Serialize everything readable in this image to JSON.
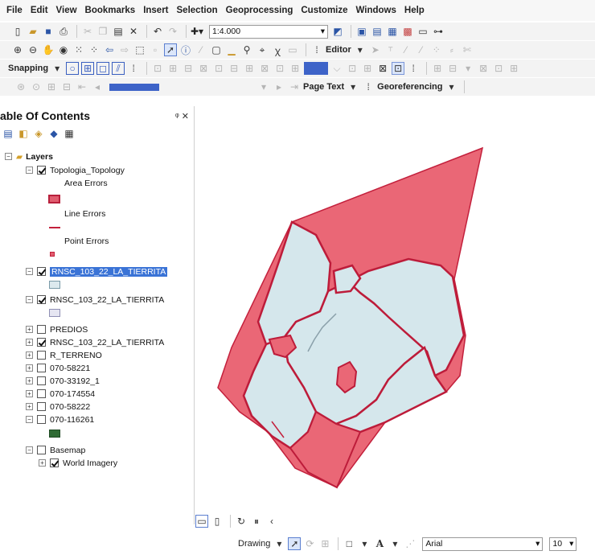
{
  "menu": [
    "File",
    "Edit",
    "View",
    "Bookmarks",
    "Insert",
    "Selection",
    "Geoprocessing",
    "Customize",
    "Windows",
    "Help"
  ],
  "toolbar": {
    "scale": "1:4.000",
    "editor_label": "Editor",
    "snapping_label": "Snapping",
    "page_text_label": "Page Text",
    "georeferencing_label": "Georeferencing"
  },
  "toc": {
    "title": "able Of Contents",
    "pin": "ᵠ ✕",
    "layers_root": "Layers",
    "topology": "Topologia_Topology",
    "area_errors": "Area Errors",
    "line_errors": "Line Errors",
    "point_errors": "Point Errors",
    "layer1": "RNSC_103_22_LA_TIERRITA",
    "layer2": "RNSC_103_22_LA_TIERRITA",
    "predios": "PREDIOS",
    "layer3": "RNSC_103_22_LA_TIERRITA",
    "r_terreno": "R_TERRENO",
    "l1": "070-58221",
    "l2": "070-33192_1",
    "l3": "070-174554",
    "l4": "070-58222",
    "l5": "070-116261",
    "basemap": "Basemap",
    "world_imagery": "World Imagery"
  },
  "drawing": {
    "label": "Drawing",
    "font": "Arial",
    "font_size": "10"
  },
  "colors": {
    "error_fill": "#ea6776",
    "error_stroke": "#c3203c",
    "parcel_fill": "#d5e7ec",
    "parcel_stroke": "#bd1c3a",
    "green_swatch": "#2f6b34",
    "selection_blue": "#3a73d6"
  }
}
